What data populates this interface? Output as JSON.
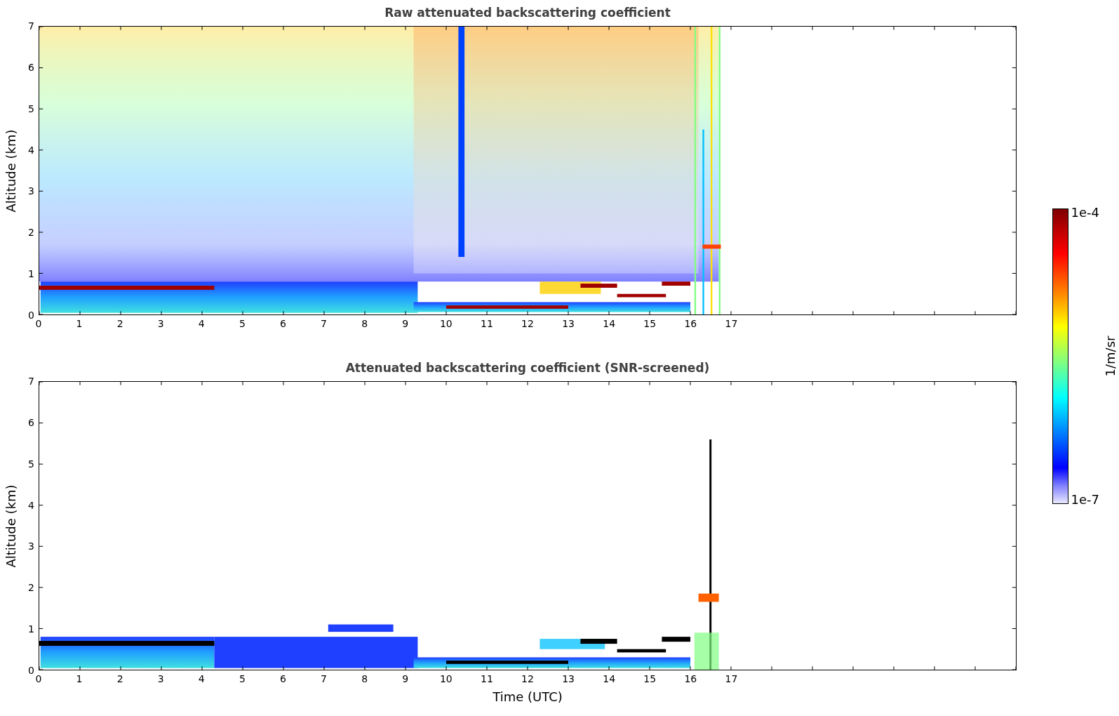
{
  "panels": [
    {
      "kind": "raw",
      "title": "Raw attenuated backscattering coefficient",
      "ylabel": "Altitude (km)",
      "yticks": [
        "7",
        "6",
        "5",
        "4",
        "3",
        "2",
        "1",
        "0"
      ],
      "xticks": [
        "0",
        "1",
        "2",
        "3",
        "4",
        "5",
        "6",
        "7",
        "8",
        "9",
        "10",
        "11",
        "12",
        "13",
        "14",
        "15",
        "16",
        "17"
      ]
    },
    {
      "kind": "screened",
      "title": "Attenuated backscattering coefficient (SNR-screened)",
      "ylabel": "Altitude (km)",
      "yticks": [
        "7",
        "6",
        "5",
        "4",
        "3",
        "2",
        "1",
        "0"
      ],
      "xticks": [
        "0",
        "1",
        "2",
        "3",
        "4",
        "5",
        "6",
        "7",
        "8",
        "9",
        "10",
        "11",
        "12",
        "13",
        "14",
        "15",
        "16",
        "17"
      ],
      "xlabel": "Time (UTC)"
    }
  ],
  "colorbar": {
    "top_label": "1e-4",
    "bottom_label": "1e-7",
    "unit": "1/m/sr"
  }
}
